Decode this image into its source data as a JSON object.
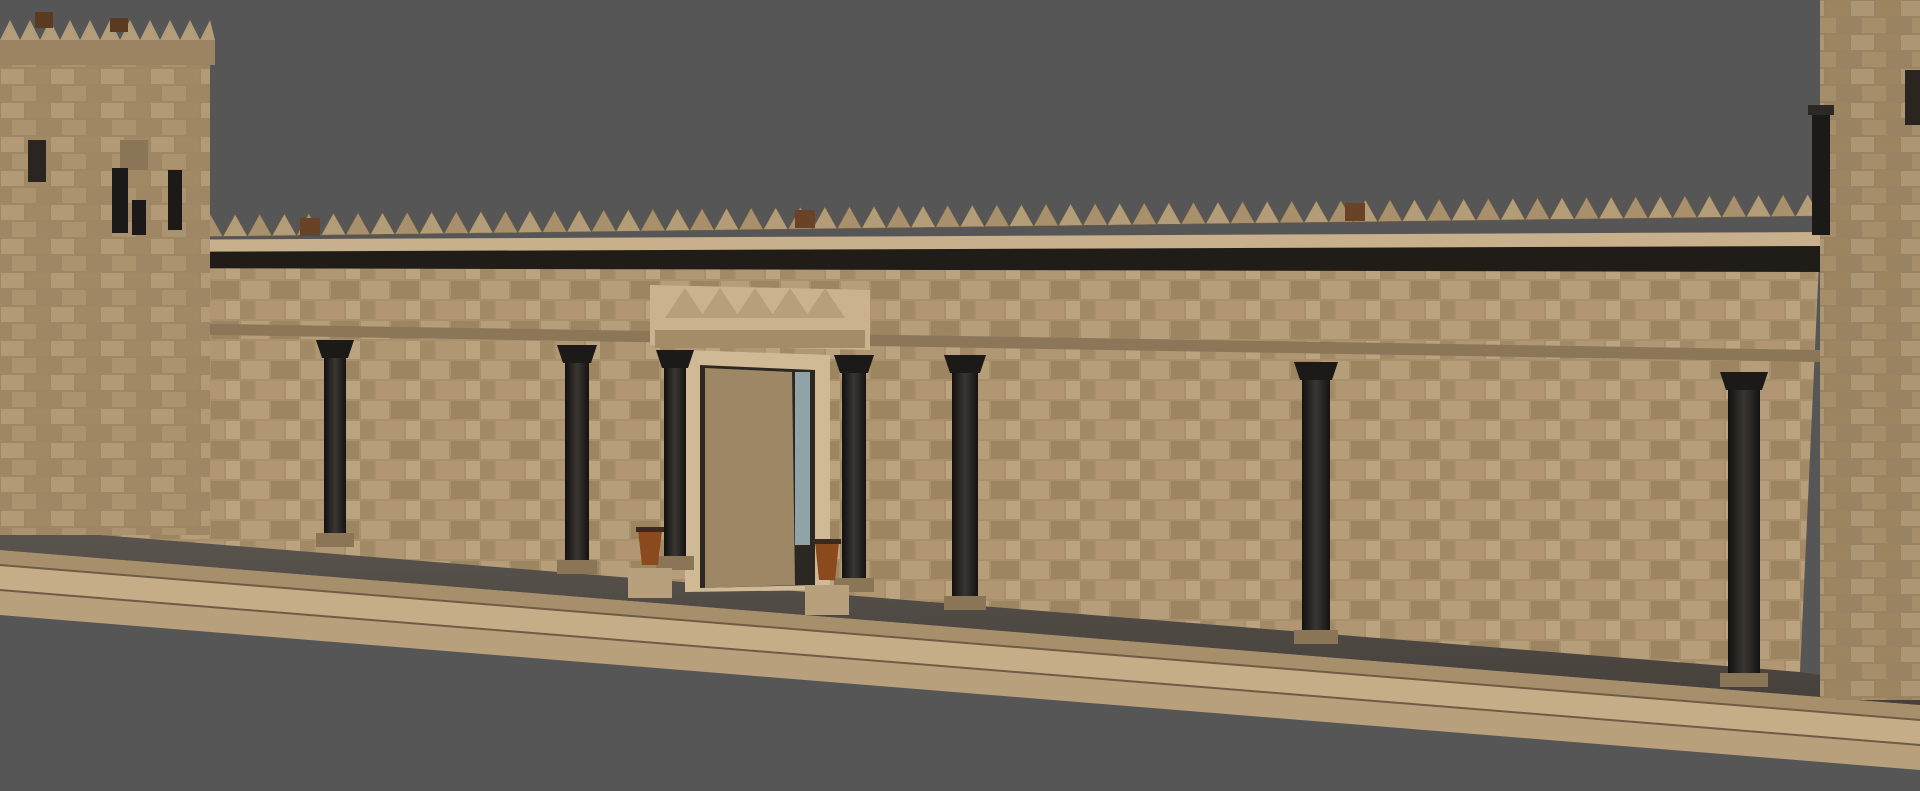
{
  "scene": {
    "subject": "",
    "colors": {
      "background": "#565656",
      "stone_light": "#c9b08a",
      "stone_mid": "#a98f6a",
      "stone_dark": "#7d6a4e",
      "mortar": "#6e5c44",
      "column": "#1f1d1b",
      "walkway": "#4c4742",
      "crenel": "#b39c78",
      "brazier": "#8a4a1e"
    }
  }
}
